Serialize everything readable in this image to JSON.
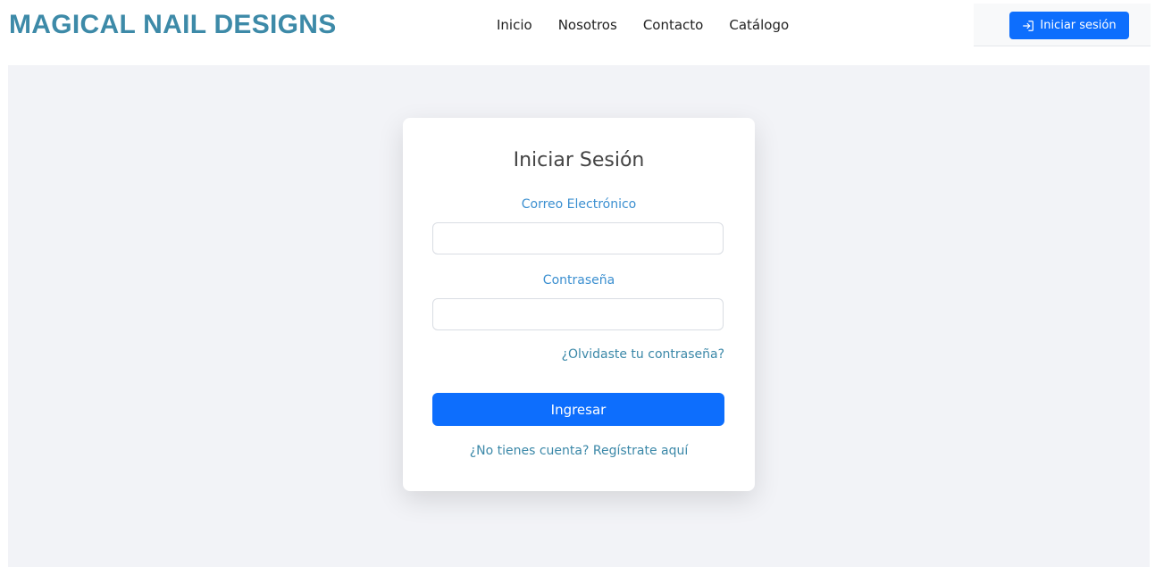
{
  "brand": {
    "name": "MAGICAL NAIL DESIGNS",
    "color": "#3d8aa8"
  },
  "nav": {
    "items": [
      {
        "label": "Inicio"
      },
      {
        "label": "Nosotros"
      },
      {
        "label": "Contacto"
      },
      {
        "label": "Catálogo"
      }
    ]
  },
  "header": {
    "login_button": {
      "label": "Iniciar sesión",
      "icon": "login-icon",
      "color": "#0d6efd"
    }
  },
  "login_form": {
    "title": "Iniciar Sesión",
    "email": {
      "label": "Correo Electrónico",
      "value": "",
      "placeholder": ""
    },
    "password": {
      "label": "Contraseña",
      "value": "",
      "placeholder": ""
    },
    "forgot_link": "¿Olvidaste tu contraseña?",
    "submit_label": "Ingresar",
    "register_link": "¿No tienes cuenta? Regístrate aquí",
    "label_color": "#3b8fd0",
    "link_color": "#3b88a8",
    "button_color": "#0d6efd"
  },
  "page": {
    "background": "#f2f3f7"
  }
}
